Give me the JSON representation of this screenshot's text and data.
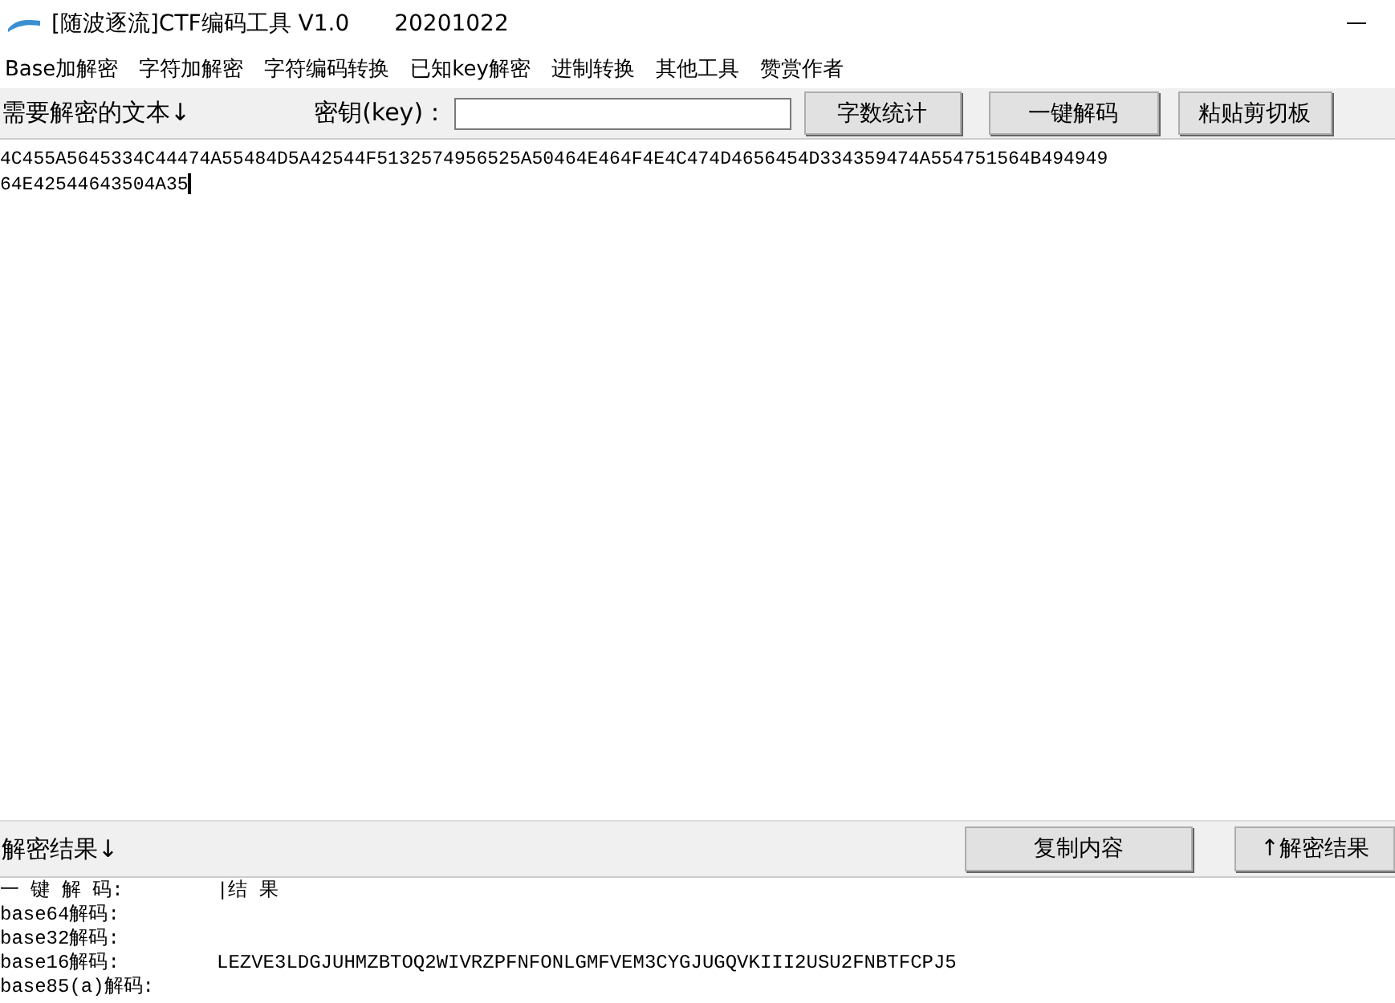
{
  "window": {
    "title": "[随波逐流]CTF编码工具 V1.0",
    "date": "20201022"
  },
  "menu": [
    "Base加解密",
    "字符加解密",
    "字符编码转换",
    "已知key解密",
    "进制转换",
    "其他工具",
    "赞赏作者"
  ],
  "input_toolbar": {
    "label": "需要解密的文本↓",
    "key_label": "密钥(key)：",
    "buttons": [
      "字数统计",
      "一键解码",
      "粘贴剪切板"
    ]
  },
  "input_text": [
    "4C455A5645334C44474A55484D5A42544F5132574956525A50464E464F4E4C474D4656454D334359474A554751564B494949",
    "64E42544643504A35"
  ],
  "result_toolbar": {
    "label": "解密结果↓",
    "buttons": [
      "复制内容",
      "↑解密结果"
    ]
  },
  "results": [
    {
      "label": "一 键 解 码:",
      "value": "|结    果"
    },
    {
      "label": "base64解码:"
    },
    {
      "label": "base32解码:"
    },
    {
      "label": "base16解码:",
      "value": "LEZVE3LDGJUHMZBTOQ2WIVRZPFNFONLGMFVEM3CYGJUGQVKIII2USU2FNBTFCPJ5"
    },
    {
      "label": "base85(a)解码:"
    }
  ]
}
